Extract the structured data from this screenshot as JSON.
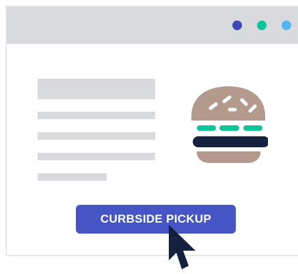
{
  "window": {
    "traffic_lights": [
      {
        "name": "dot-navy",
        "color": "#3e47b8"
      },
      {
        "name": "dot-green",
        "color": "#10c49a"
      },
      {
        "name": "dot-blue",
        "color": "#55b4f7"
      }
    ]
  },
  "illustration": {
    "icon": "burger-icon",
    "colors": {
      "bun": "#b49a8c",
      "sesame": "#ffffff",
      "lettuce": "#10c49a",
      "patty": "#14213f"
    }
  },
  "cta": {
    "label": "CURBSIDE PICKUP",
    "color": "#4655c5"
  },
  "pointer": {
    "icon": "mouse-pointer-icon",
    "color": "#14213f"
  }
}
